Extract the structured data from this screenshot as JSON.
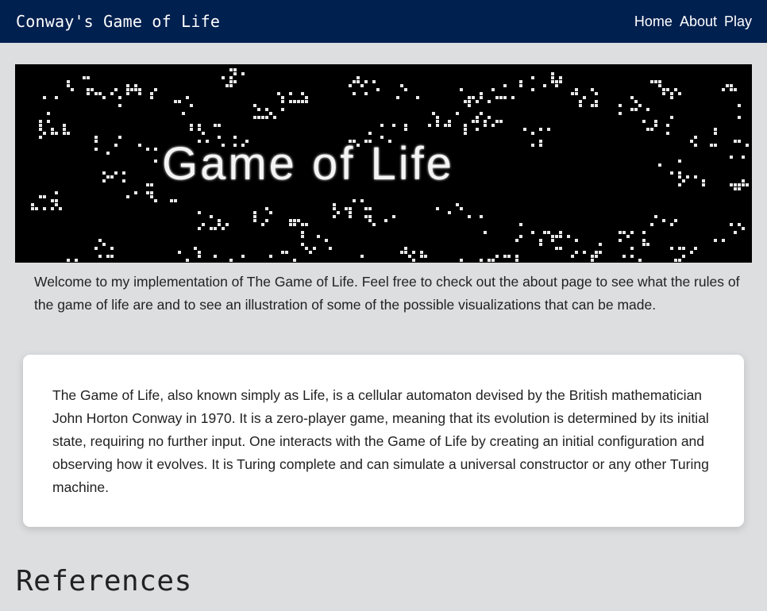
{
  "navbar": {
    "brand": "Conway's Game of Life",
    "links": [
      "Home",
      "About",
      "Play"
    ]
  },
  "banner": {
    "title": "Game of Life"
  },
  "intro": {
    "text": "Welcome to my implementation of The Game of Life. Feel free to check out the about page to see what the rules of the game of life are and to see an illustration of some of the possible visualizations that can be made."
  },
  "card": {
    "text": "The Game of Life, also known simply as Life, is a cellular automaton devised by the British mathematician John Horton Conway in 1970. It is a zero-player game, meaning that its evolution is determined by its initial state, requiring no further input. One interacts with the Game of Life by creating an initial configuration and observing how it evolves. It is Turing complete and can simulate a universal constructor or any other Turing machine."
  },
  "references": {
    "heading": "References"
  },
  "colors": {
    "navbar": "#00204f",
    "background": "#dcdee0",
    "card": "#ffffff"
  }
}
